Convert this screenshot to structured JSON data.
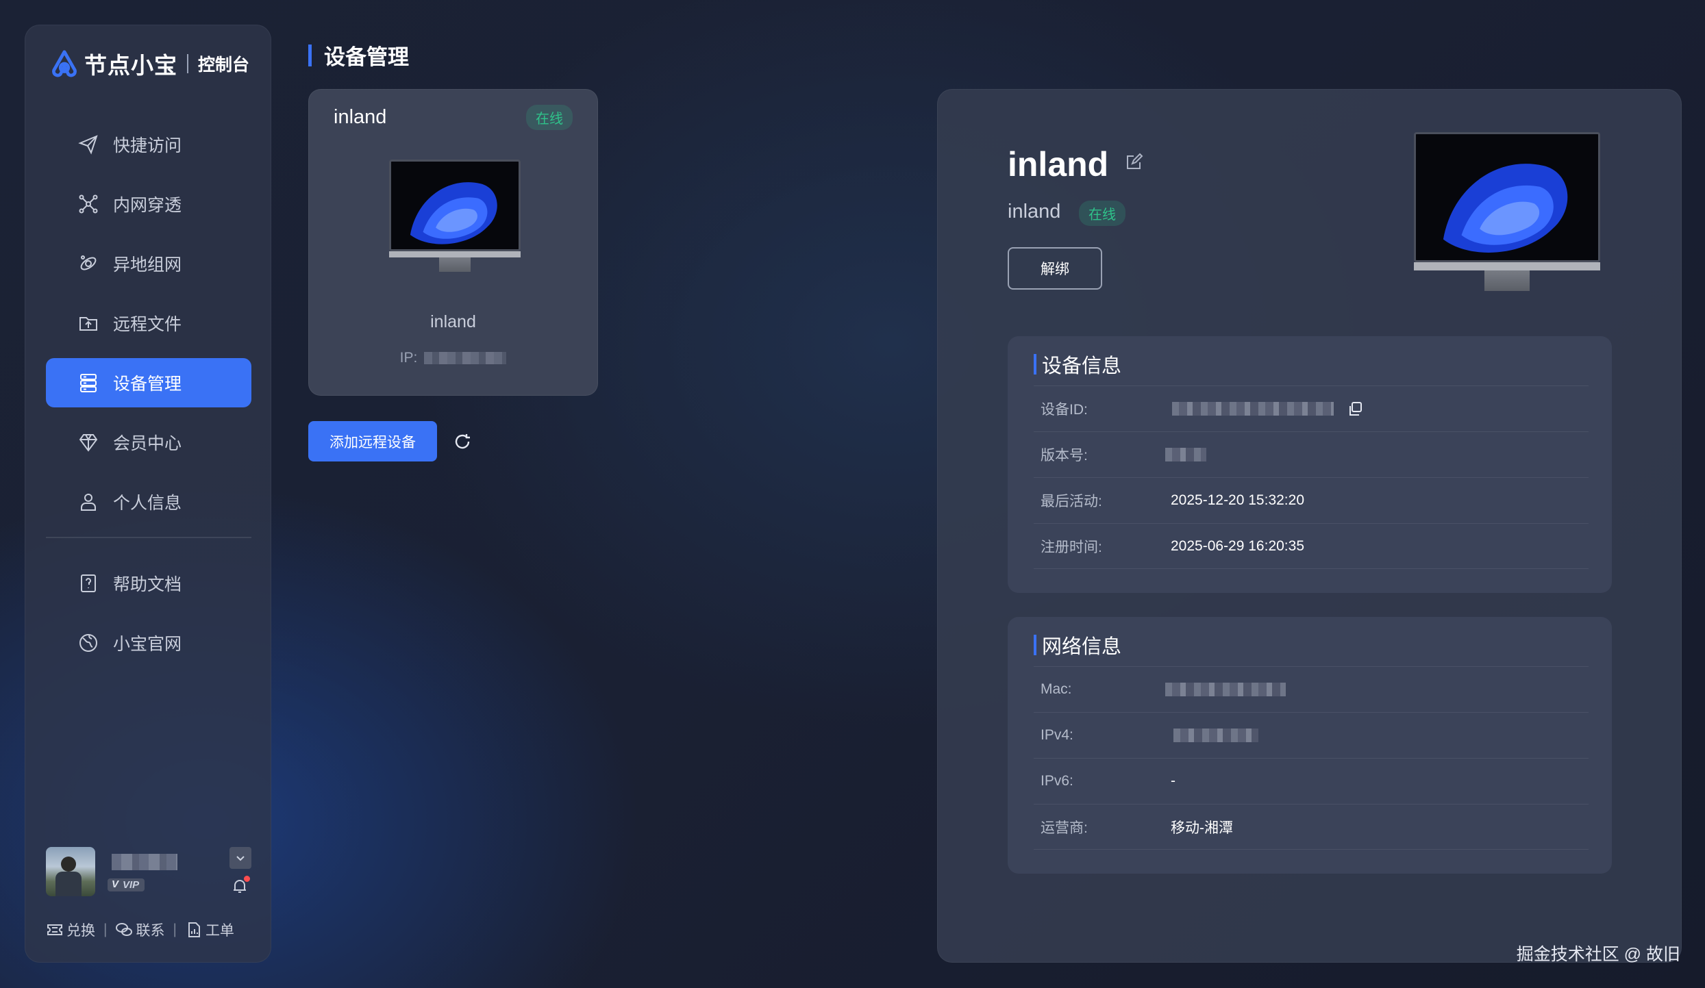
{
  "brand": {
    "name": "节点小宝",
    "sub": "控制台"
  },
  "nav": {
    "items": [
      {
        "label": "快捷访问",
        "icon": "send-icon"
      },
      {
        "label": "内网穿透",
        "icon": "network-icon"
      },
      {
        "label": "异地组网",
        "icon": "orbit-icon"
      },
      {
        "label": "远程文件",
        "icon": "folder-upload-icon"
      },
      {
        "label": "设备管理",
        "icon": "server-icon",
        "active": true
      },
      {
        "label": "会员中心",
        "icon": "diamond-icon"
      },
      {
        "label": "个人信息",
        "icon": "user-icon"
      }
    ],
    "extra": [
      {
        "label": "帮助文档",
        "icon": "help-doc-icon"
      },
      {
        "label": "小宝官网",
        "icon": "globe-icon"
      }
    ]
  },
  "user": {
    "badge": "VIP"
  },
  "footer": {
    "redeem": "兑换",
    "contact": "联系",
    "ticket": "工单"
  },
  "page": {
    "title": "设备管理"
  },
  "device_card": {
    "name": "inland",
    "status": "在线",
    "label": "inland",
    "ip_label": "IP:"
  },
  "actions": {
    "add_device": "添加远程设备"
  },
  "detail": {
    "name": "inland",
    "sub_name": "inland",
    "status": "在线",
    "unbind": "解绑",
    "device_info": {
      "title": "设备信息",
      "rows": [
        {
          "key": "设备ID:",
          "value": ""
        },
        {
          "key": "版本号:",
          "value": ""
        },
        {
          "key": "最后活动:",
          "value": "2025-12-20 15:32:20"
        },
        {
          "key": "注册时间:",
          "value": "2025-06-29 16:20:35"
        }
      ]
    },
    "network_info": {
      "title": "网络信息",
      "rows": [
        {
          "key": "Mac:",
          "value": ""
        },
        {
          "key": "IPv4:",
          "value": ""
        },
        {
          "key": "IPv6:",
          "value": "-"
        },
        {
          "key": "运营商:",
          "value": "移动-湘潭"
        }
      ]
    }
  },
  "watermark": "掘金技术社区 @ 故旧",
  "colors": {
    "accent": "#3a72f5",
    "online": "#2fc28a",
    "background": "#1b2235"
  }
}
